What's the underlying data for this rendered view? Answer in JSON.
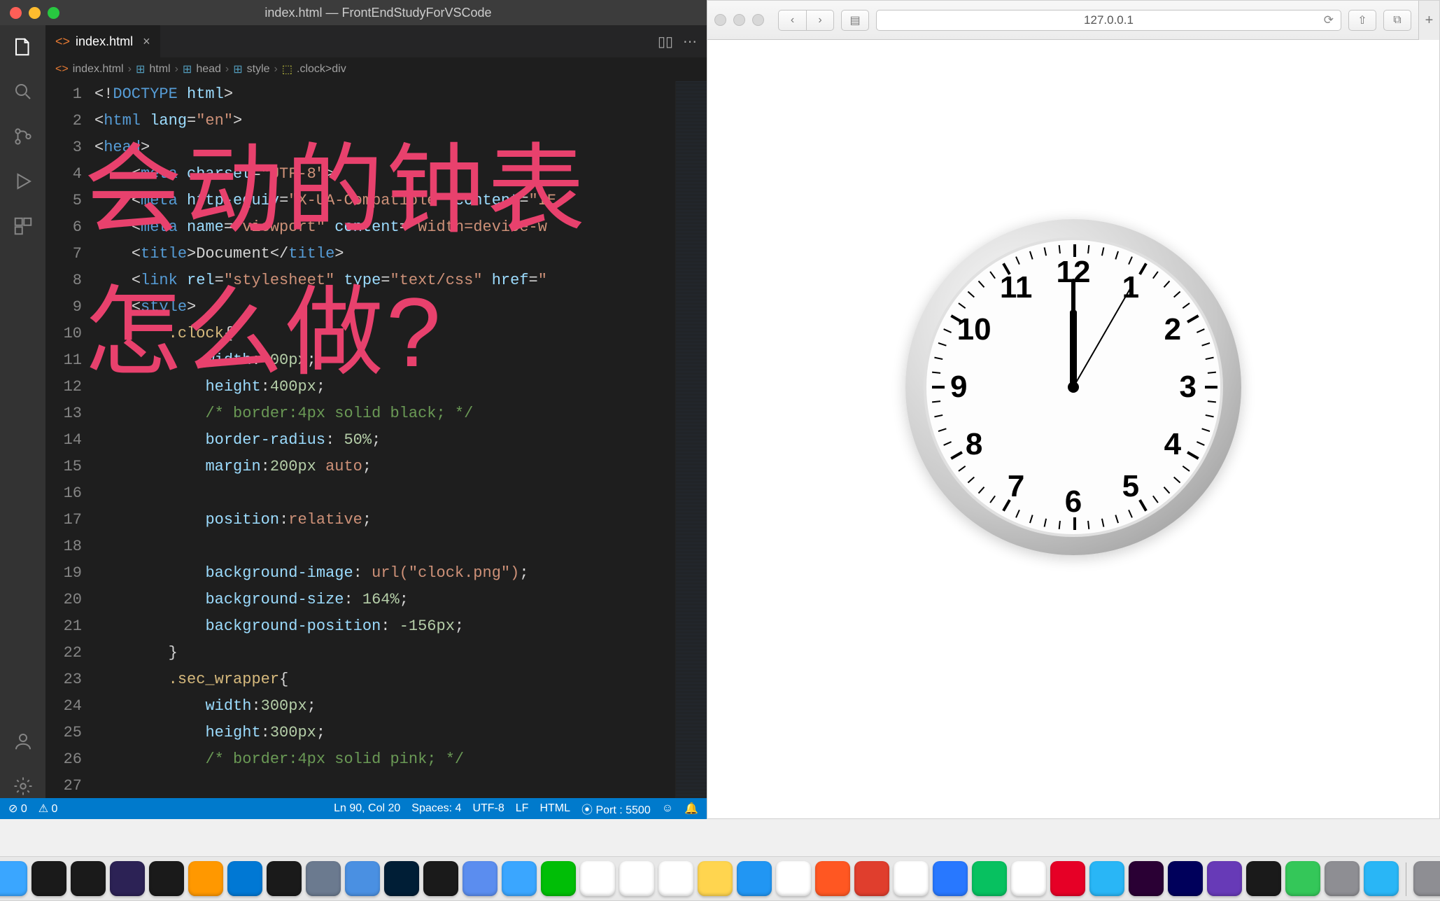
{
  "vscode": {
    "window_title": "index.html — FrontEndStudyForVSCode",
    "tab": {
      "name": "index.html",
      "close": "×"
    },
    "tabs_split_icon": "▯▯",
    "tabs_more_icon": "⋯",
    "breadcrumbs": [
      "index.html",
      "html",
      "head",
      "style",
      ".clock>div"
    ],
    "code": {
      "lines": [
        {
          "n": 1,
          "html": "<span class='tok-punct'>&lt;!</span><span class='tok-doctype'>DOCTYPE</span> <span class='tok-attr'>html</span><span class='tok-punct'>&gt;</span>"
        },
        {
          "n": 2,
          "html": "<span class='tok-punct'>&lt;</span><span class='tok-tag'>html</span> <span class='tok-attr'>lang</span>=<span class='tok-str'>\"en\"</span><span class='tok-punct'>&gt;</span>"
        },
        {
          "n": 3,
          "html": "<span class='tok-punct'>&lt;</span><span class='tok-tag'>head</span><span class='tok-punct'>&gt;</span>"
        },
        {
          "n": 4,
          "html": "    <span class='tok-punct'>&lt;</span><span class='tok-tag'>meta</span> <span class='tok-attr'>charset</span>=<span class='tok-str'>\"UTF-8\"</span><span class='tok-punct'>&gt;</span>"
        },
        {
          "n": 5,
          "html": "    <span class='tok-punct'>&lt;</span><span class='tok-tag'>meta</span> <span class='tok-attr'>http-equiv</span>=<span class='tok-str'>\"X-UA-Compatible\"</span> <span class='tok-attr'>content</span>=<span class='tok-str'>\"IE</span>"
        },
        {
          "n": 6,
          "html": "    <span class='tok-punct'>&lt;</span><span class='tok-tag'>meta</span> <span class='tok-attr'>name</span>=<span class='tok-str'>\"viewport\"</span> <span class='tok-attr'>content</span>=<span class='tok-str'>\"width=device-w</span>"
        },
        {
          "n": 7,
          "html": "    <span class='tok-punct'>&lt;</span><span class='tok-tag'>title</span><span class='tok-punct'>&gt;</span>Document<span class='tok-punct'>&lt;/</span><span class='tok-tag'>title</span><span class='tok-punct'>&gt;</span>"
        },
        {
          "n": 8,
          "html": "    <span class='tok-punct'>&lt;</span><span class='tok-tag'>link</span> <span class='tok-attr'>rel</span>=<span class='tok-str'>\"stylesheet\"</span> <span class='tok-attr'>type</span>=<span class='tok-str'>\"text/css\"</span> <span class='tok-attr'>href</span>=<span class='tok-str'>\"</span>"
        },
        {
          "n": 9,
          "html": "    <span class='tok-punct'>&lt;</span><span class='tok-tag'>style</span><span class='tok-punct'>&gt;</span>"
        },
        {
          "n": 10,
          "html": "        <span class='tok-sel'>.clock</span>{"
        },
        {
          "n": 11,
          "html": "            <span class='tok-prop'>width</span>:<span class='tok-num'>400px</span>;"
        },
        {
          "n": 12,
          "html": "            <span class='tok-prop'>height</span>:<span class='tok-num'>400px</span>;"
        },
        {
          "n": 13,
          "html": "            <span class='tok-com'>/* border:4px solid black; */</span>"
        },
        {
          "n": 14,
          "html": "            <span class='tok-prop'>border-radius</span>: <span class='tok-num'>50%</span>;"
        },
        {
          "n": 15,
          "html": "            <span class='tok-prop'>margin</span>:<span class='tok-num'>200px</span> <span class='tok-val'>auto</span>;"
        },
        {
          "n": 16,
          "html": ""
        },
        {
          "n": 17,
          "html": "            <span class='tok-prop'>position</span>:<span class='tok-val'>relative</span>;"
        },
        {
          "n": 18,
          "html": ""
        },
        {
          "n": 19,
          "html": "            <span class='tok-prop'>background-image</span>: <span class='tok-val'>url(</span><span class='tok-str'>\"clock.png\"</span><span class='tok-val'>)</span>;"
        },
        {
          "n": 20,
          "html": "            <span class='tok-prop'>background-size</span>: <span class='tok-num'>164%</span>;"
        },
        {
          "n": 21,
          "html": "            <span class='tok-prop'>background-position</span>: <span class='tok-num'>-156px</span>;"
        },
        {
          "n": 22,
          "html": "        }"
        },
        {
          "n": 23,
          "html": "        <span class='tok-sel'>.sec_wrapper</span>{"
        },
        {
          "n": 24,
          "html": "            <span class='tok-prop'>width</span>:<span class='tok-num'>300px</span>;"
        },
        {
          "n": 25,
          "html": "            <span class='tok-prop'>height</span>:<span class='tok-num'>300px</span>;"
        },
        {
          "n": 26,
          "html": "            <span class='tok-com'>/* border:4px solid pink; */</span>"
        },
        {
          "n": 27,
          "html": ""
        }
      ]
    },
    "status": {
      "errors": "⊘ 0",
      "warnings": "⚠ 0",
      "cursor": "Ln 90, Col 20",
      "spaces": "Spaces: 4",
      "encoding": "UTF-8",
      "eol": "LF",
      "lang": "HTML",
      "port": "⦿ Port : 5500",
      "feedback": "☺",
      "bell": "🔔"
    }
  },
  "safari": {
    "url": "127.0.0.1"
  },
  "overlay": {
    "line1": "会动的钟表",
    "line2": "怎么做?"
  },
  "clock": {
    "numbers": [
      "12",
      "1",
      "2",
      "3",
      "4",
      "5",
      "6",
      "7",
      "8",
      "9",
      "10",
      "11"
    ]
  },
  "dock": {
    "apps": [
      {
        "name": "notes",
        "bg": "#f7e26b"
      },
      {
        "name": "finder",
        "bg": "#3aa6ff"
      },
      {
        "name": "intellij",
        "bg": "#1a1a1a"
      },
      {
        "name": "pycharm",
        "bg": "#1a1a1a"
      },
      {
        "name": "eclipse",
        "bg": "#2c2255"
      },
      {
        "name": "terminal",
        "bg": "#1a1a1a"
      },
      {
        "name": "sublime",
        "bg": "#ff9800"
      },
      {
        "name": "vscode",
        "bg": "#0078d4"
      },
      {
        "name": "webstorm",
        "bg": "#1a1a1a"
      },
      {
        "name": "utility",
        "bg": "#6b7a8f"
      },
      {
        "name": "app-blue",
        "bg": "#4a90e2"
      },
      {
        "name": "photoshop",
        "bg": "#001e36"
      },
      {
        "name": "pycharm2",
        "bg": "#1a1a1a"
      },
      {
        "name": "compass",
        "bg": "#5b8def"
      },
      {
        "name": "safari",
        "bg": "#3aa6ff"
      },
      {
        "name": "iqiyi",
        "bg": "#00be06"
      },
      {
        "name": "reminders",
        "bg": "#fff"
      },
      {
        "name": "stickies",
        "bg": "#fff"
      },
      {
        "name": "calendar",
        "bg": "#fff"
      },
      {
        "name": "yellow-note",
        "bg": "#ffd54f"
      },
      {
        "name": "edraw",
        "bg": "#2196f3"
      },
      {
        "name": "leaf",
        "bg": "#fff"
      },
      {
        "name": "xmind",
        "bg": "#ff5722"
      },
      {
        "name": "wps",
        "bg": "#e03e2d"
      },
      {
        "name": "cloud",
        "bg": "#fff"
      },
      {
        "name": "baidu",
        "bg": "#2878ff"
      },
      {
        "name": "wechat",
        "bg": "#07c160"
      },
      {
        "name": "qq",
        "bg": "#fff"
      },
      {
        "name": "netease",
        "bg": "#e60026"
      },
      {
        "name": "sync",
        "bg": "#29b6f6"
      },
      {
        "name": "premiere",
        "bg": "#2a0034"
      },
      {
        "name": "aftereffects",
        "bg": "#00005b"
      },
      {
        "name": "purple",
        "bg": "#673ab7"
      },
      {
        "name": "share",
        "bg": "#1a1a1a"
      },
      {
        "name": "messages",
        "bg": "#34c759"
      },
      {
        "name": "settings",
        "bg": "#8e8e93"
      },
      {
        "name": "bird",
        "bg": "#29b6f6"
      }
    ],
    "right": [
      {
        "name": "downloads",
        "bg": "#8e8e93"
      },
      {
        "name": "trash",
        "bg": "#d0d0d0"
      }
    ]
  }
}
